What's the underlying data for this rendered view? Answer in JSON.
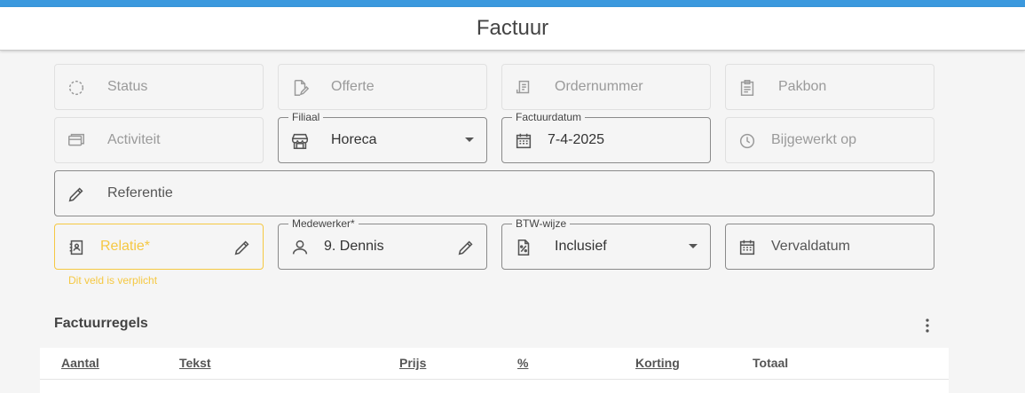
{
  "colors": {
    "accent": "#3b99de",
    "error": "#f5c842"
  },
  "header": {
    "title": "Factuur"
  },
  "fields": {
    "status": {
      "placeholder": "Status",
      "icon": "loading-circle-icon"
    },
    "offerte": {
      "placeholder": "Offerte",
      "icon": "document-edit-icon"
    },
    "ordernummer": {
      "placeholder": "Ordernummer",
      "icon": "receipt-icon"
    },
    "pakbon": {
      "placeholder": "Pakbon",
      "icon": "clipboard-icon"
    },
    "activiteit": {
      "placeholder": "Activiteit",
      "icon": "cards-icon"
    },
    "filiaal": {
      "label": "Filiaal",
      "value": "Horeca",
      "icon": "store-icon"
    },
    "factuurdatum": {
      "label": "Factuurdatum",
      "value": "7-4-2025",
      "icon": "calendar-icon"
    },
    "bijgewerkt": {
      "placeholder": "Bijgewerkt op",
      "icon": "clock-icon"
    },
    "referentie": {
      "placeholder": "Referentie",
      "icon": "pencil-icon"
    },
    "relatie": {
      "placeholder": "Relatie*",
      "icon": "contact-book-icon",
      "error": "Dit veld is verplicht"
    },
    "medewerker": {
      "label": "Medewerker*",
      "value": "9. Dennis",
      "icon": "person-icon"
    },
    "btw": {
      "label": "BTW-wijze",
      "value": "Inclusief",
      "icon": "percent-document-icon"
    },
    "vervaldatum": {
      "placeholder": "Vervaldatum",
      "icon": "calendar-icon"
    }
  },
  "factuurregels": {
    "title": "Factuurregels",
    "columns": [
      "Aantal",
      "Tekst",
      "Prijs",
      "%",
      "Korting",
      "Totaal"
    ]
  }
}
